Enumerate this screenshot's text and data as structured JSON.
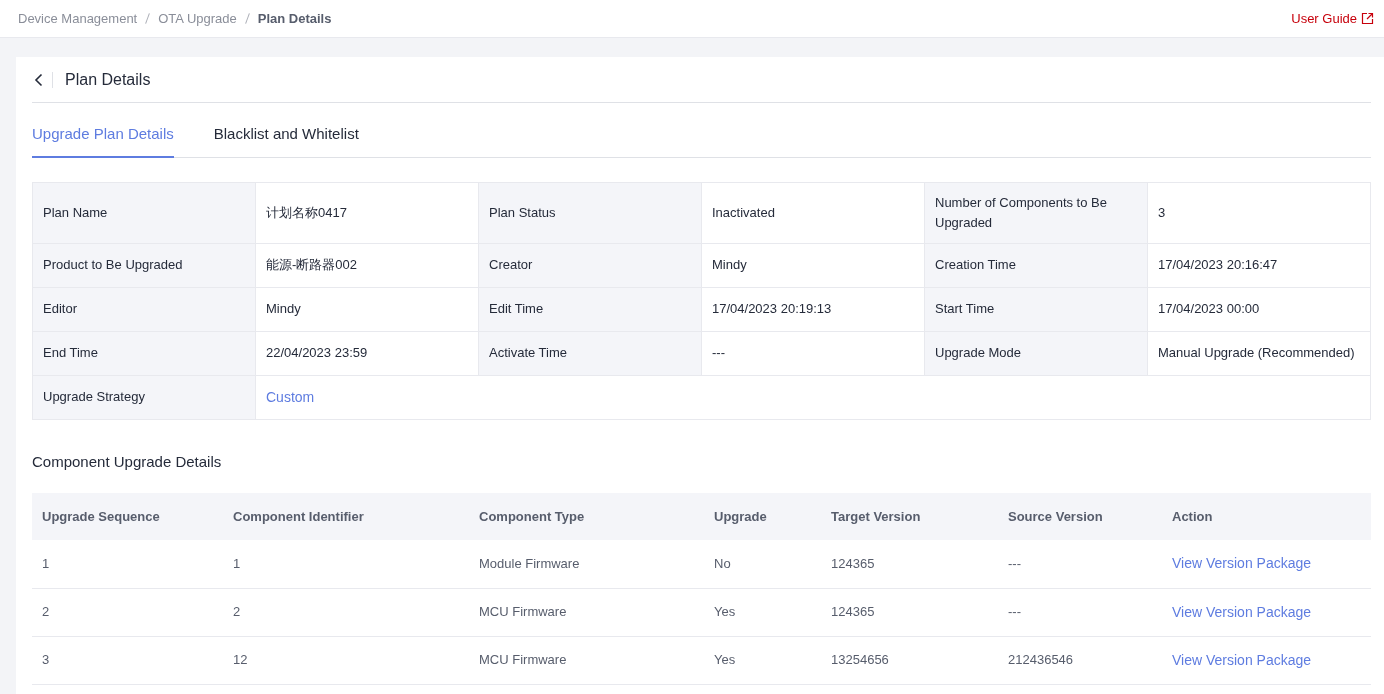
{
  "breadcrumb": [
    {
      "label": "Device Management",
      "current": false
    },
    {
      "label": "OTA Upgrade",
      "current": false
    },
    {
      "label": "Plan Details",
      "current": true
    }
  ],
  "user_guide": "User Guide",
  "page_title": "Plan Details",
  "tabs": [
    {
      "label": "Upgrade Plan Details",
      "selected": true
    },
    {
      "label": "Blacklist and Whitelist",
      "selected": false
    }
  ],
  "detail_rows": [
    {
      "fields": [
        {
          "label": "Plan Name",
          "value": "计划名称0417",
          "kind": "text"
        },
        {
          "label": "Plan Status",
          "value": "Inactivated",
          "kind": "text"
        },
        {
          "label": "Number of Components to Be Upgraded",
          "value": "3",
          "kind": "text"
        }
      ]
    },
    {
      "fields": [
        {
          "label": "Product to Be Upgraded",
          "value": "能源-断路器002",
          "kind": "text"
        },
        {
          "label": "Creator",
          "value": "Mindy",
          "kind": "text"
        },
        {
          "label": "Creation Time",
          "value": "17/04/2023 20:16:47",
          "kind": "text"
        }
      ]
    },
    {
      "fields": [
        {
          "label": "Editor",
          "value": "Mindy",
          "kind": "text"
        },
        {
          "label": "Edit Time",
          "value": "17/04/2023 20:19:13",
          "kind": "text"
        },
        {
          "label": "Start Time",
          "value": "17/04/2023 00:00",
          "kind": "text"
        }
      ]
    },
    {
      "fields": [
        {
          "label": "End Time",
          "value": "22/04/2023 23:59",
          "kind": "text"
        },
        {
          "label": "Activate Time",
          "value": "---",
          "kind": "text"
        },
        {
          "label": "Upgrade Mode",
          "value": "Manual Upgrade (Recommended)",
          "kind": "text"
        }
      ]
    },
    {
      "fields": [
        {
          "label": "Upgrade Strategy",
          "value": "Custom",
          "kind": "link"
        }
      ]
    }
  ],
  "components": {
    "title": "Component Upgrade Details",
    "columns": [
      "Upgrade Sequence",
      "Component Identifier",
      "Component Type",
      "Upgrade",
      "Target Version",
      "Source Version",
      "Action"
    ],
    "rows": [
      {
        "cells": [
          "1",
          "1",
          "Module Firmware",
          "No",
          "124365",
          "---"
        ],
        "action": "View Version Package"
      },
      {
        "cells": [
          "2",
          "2",
          "MCU Firmware",
          "Yes",
          "124365",
          "---"
        ],
        "action": "View Version Package"
      },
      {
        "cells": [
          "3",
          "12",
          "MCU Firmware",
          "Yes",
          "13254656",
          "212436546"
        ],
        "action": "View Version Package"
      }
    ]
  }
}
